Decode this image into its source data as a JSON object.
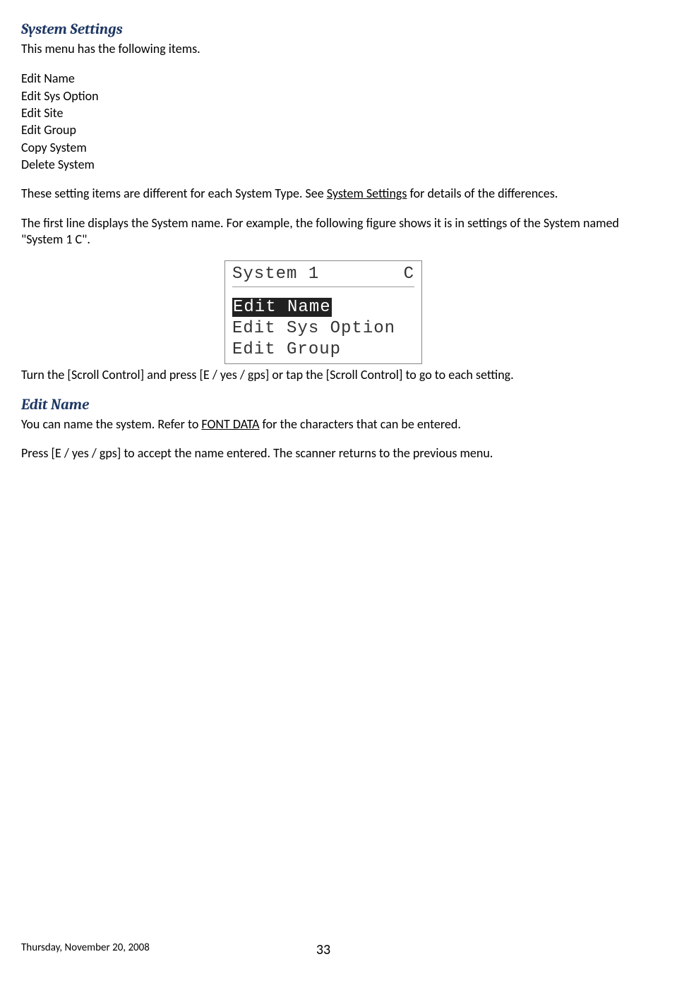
{
  "heading1": "System Settings",
  "intro": "This menu has the following items.",
  "menu_items": [
    "Edit Name",
    "Edit Sys Option",
    "Edit Site",
    "Edit Group",
    "Copy System",
    "Delete System"
  ],
  "para_diff_a": "These setting items are different for each System Type. See ",
  "link_system_settings": "System Settings",
  "para_diff_b": " for details of the differences.",
  "para_first_line": "The first line displays the System name. For example, the following figure shows it is in settings of the System named \"System 1  C\".",
  "display": {
    "header_left": "System 1",
    "header_right": "C",
    "row_selected": "Edit Name",
    "row2": "Edit Sys Option",
    "row3": "Edit Group"
  },
  "para_scroll": "Turn the [Scroll Control] and press [E / yes / gps] or tap the [Scroll Control] to go to each setting.",
  "heading2": "Edit Name",
  "para_edit_a": "You can name the system. Refer to ",
  "link_font_data": "FONT DATA",
  "para_edit_b": " for the characters that can be entered.",
  "para_accept": "Press [E / yes / gps] to accept the name entered. The scanner returns to the previous menu.",
  "footer_date": "Thursday, November 20, 2008",
  "page_number": "33"
}
